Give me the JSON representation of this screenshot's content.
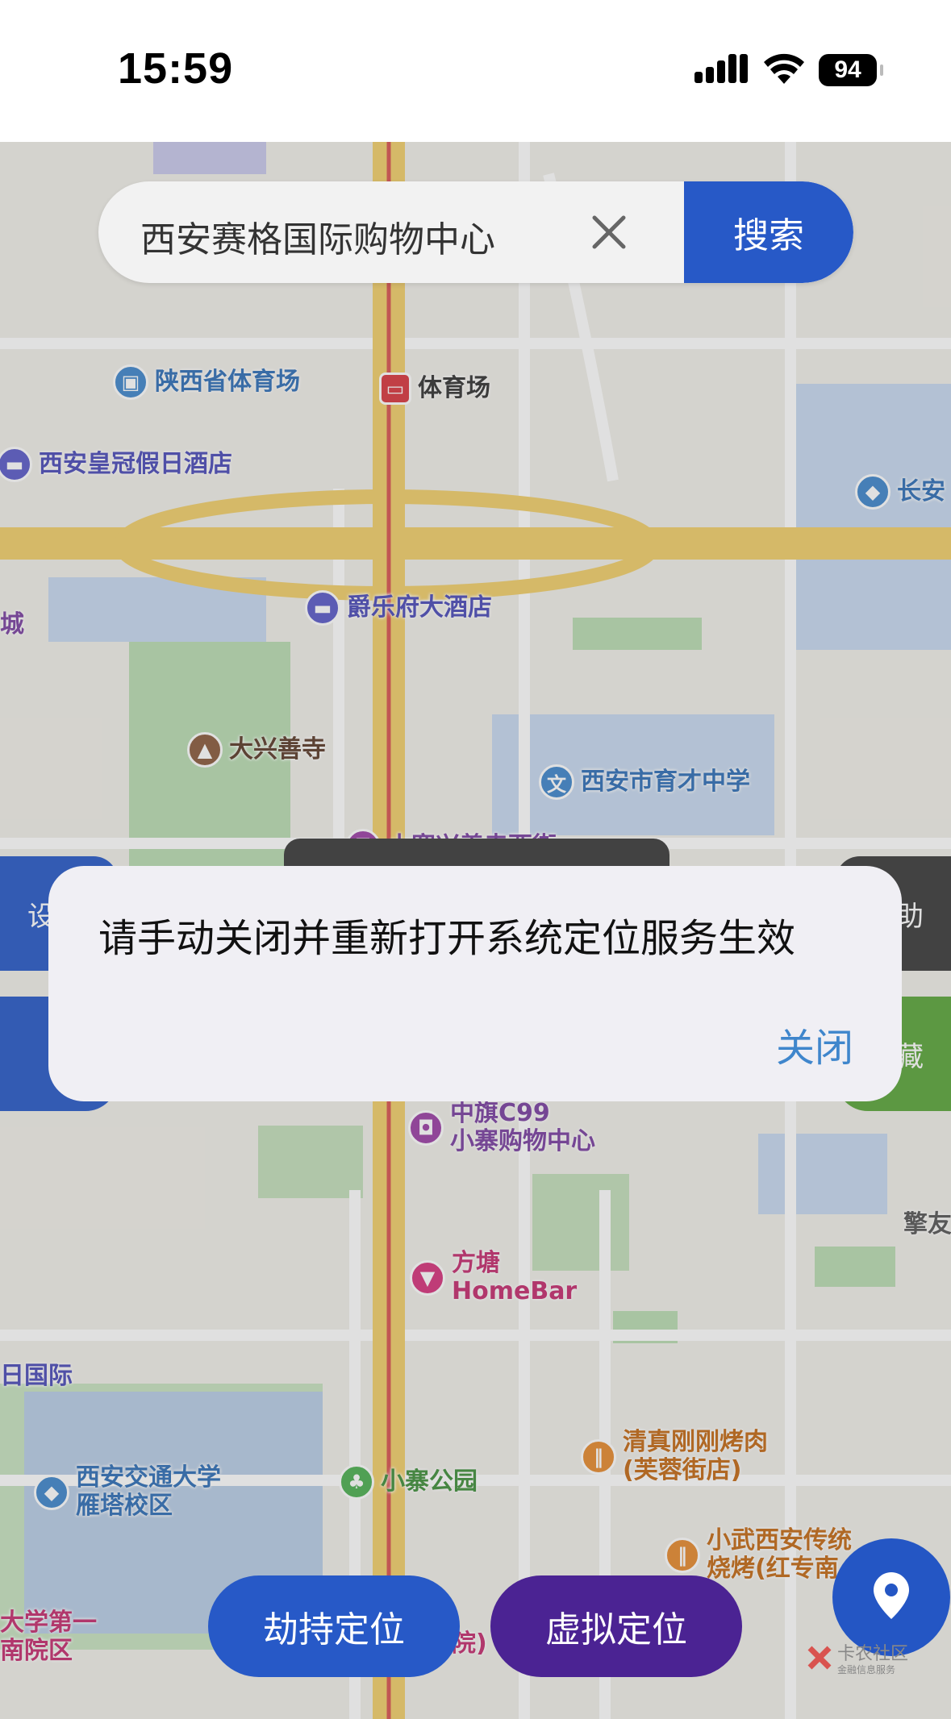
{
  "status_bar": {
    "time": "15:59",
    "battery": "94"
  },
  "search": {
    "query": "西安赛格国际购物中心",
    "button_label": "搜索"
  },
  "map_labels": [
    {
      "text": "陕西省体育场",
      "icon": "bus-icon"
    },
    {
      "text": "体育场",
      "icon": "metro-icon"
    },
    {
      "text": "西安皇冠假日酒店",
      "icon": "hotel-icon"
    },
    {
      "text": "长安",
      "icon": "school-icon"
    },
    {
      "text": "爵乐府大酒店",
      "icon": "hotel-icon"
    },
    {
      "text": "城",
      "icon": ""
    },
    {
      "text": "大兴善寺",
      "icon": "temple-icon"
    },
    {
      "text": "西安市育才中学",
      "icon": "school-icon"
    },
    {
      "text": "小寨兴善寺西街",
      "icon": "shop-icon"
    },
    {
      "text": "中旗C99",
      "icon": "shop-icon"
    },
    {
      "text": "小寨购物中心",
      "icon": ""
    },
    {
      "text": "擎友",
      "icon": ""
    },
    {
      "text": "方塘",
      "icon": "bar-icon"
    },
    {
      "text": "HomeBar",
      "icon": ""
    },
    {
      "text": "日国际",
      "icon": ""
    },
    {
      "text": "西安交通大学",
      "icon": "school-icon"
    },
    {
      "text": "雁塔校区",
      "icon": ""
    },
    {
      "text": "小寨公园",
      "icon": "park-icon"
    },
    {
      "text": "清真刚刚烤肉",
      "icon": "food-icon"
    },
    {
      "text": "(芙蓉街店)",
      "icon": ""
    },
    {
      "text": "小武西安传统",
      "icon": "food-icon"
    },
    {
      "text": "烧烤(红专南",
      "icon": ""
    },
    {
      "text": "大学第一",
      "icon": ""
    },
    {
      "text": "南院区",
      "icon": ""
    },
    {
      "text": "院)",
      "icon": ""
    }
  ],
  "side_buttons": {
    "left_top": "设",
    "right_top": "助",
    "right_bottom": "藏"
  },
  "dialog": {
    "message": "请手动关闭并重新打开系统定位服务生效",
    "close_label": "关闭"
  },
  "bottom_buttons": {
    "hijack_label": "劫持定位",
    "virtual_label": "虚拟定位"
  },
  "watermark": {
    "text": "卡农社区",
    "subtext": "金融信息服务"
  },
  "colors": {
    "primary_blue": "#2759c7",
    "purple": "#4b2393",
    "dialog_link": "#3f86cc",
    "green": "#5aa53a",
    "dark": "#3a3a3a"
  }
}
